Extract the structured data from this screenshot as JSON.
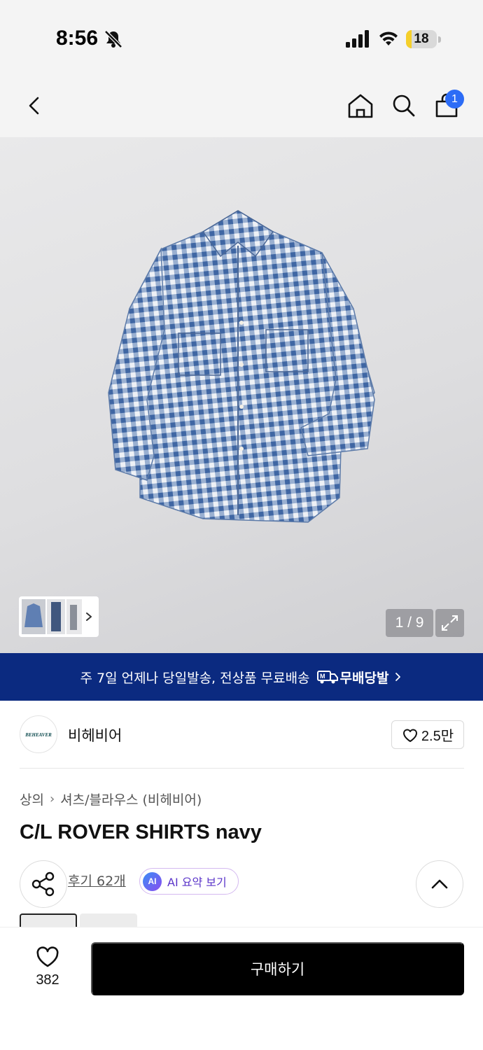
{
  "status_bar": {
    "time": "8:56",
    "battery_level": "18",
    "battery_fraction": 0.18,
    "icons": [
      "bell-slash-icon",
      "cellular-signal-icon",
      "wifi-icon",
      "battery-icon"
    ]
  },
  "nav": {
    "icons": [
      "back-arrow-icon",
      "home-icon",
      "search-icon",
      "shopping-bag-icon"
    ],
    "cart_badge": "1"
  },
  "gallery": {
    "pager": "1 / 9",
    "icons": [
      "thumbnail-chevron-icon",
      "expand-icon"
    ]
  },
  "banner": {
    "text": "주 7일 언제나 당일발송, 전상품 무료배송",
    "brand": "무배당발",
    "icon": "truck-icon"
  },
  "brand": {
    "logo_text": "BEHEAVER",
    "name": "비헤비어",
    "likes": "2.5만"
  },
  "breadcrumb": {
    "category": "상의",
    "subcategory": "셔츠/블라우스 (비헤비어)"
  },
  "product": {
    "title": "C/L ROVER SHIRTS navy"
  },
  "actions": {
    "review": "후기 62개",
    "ai_badge": "AI",
    "ai_label": "AI 요약 보기"
  },
  "bottom_bar": {
    "wish_count": "382",
    "buy_label": "구매하기"
  },
  "colors": {
    "banner_bg": "#0b2a80",
    "badge_blue": "#2c6cf6",
    "buy_button": "#000000",
    "ai_accent": "#5a34c9"
  }
}
